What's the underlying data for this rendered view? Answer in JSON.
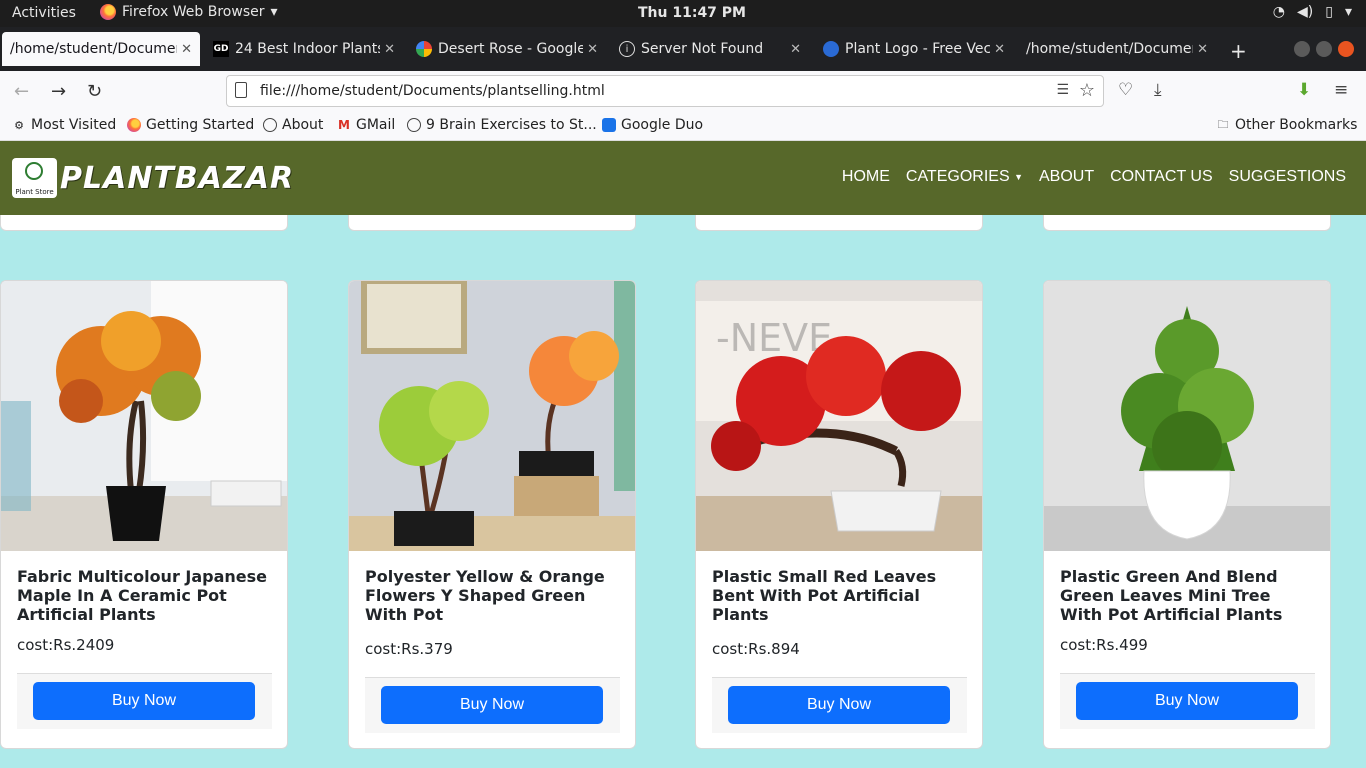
{
  "system_bar": {
    "activities": "Activities",
    "app_menu": "Firefox Web Browser",
    "clock": "Thu 11:47 PM"
  },
  "tabs": [
    {
      "label": "/home/student/Documen",
      "favicon": "none",
      "active": true
    },
    {
      "label": "24 Best Indoor Plants",
      "favicon": "gd-icon",
      "active": false
    },
    {
      "label": "Desert Rose - Google",
      "favicon": "google-icon",
      "active": false
    },
    {
      "label": "Server Not Found",
      "favicon": "info-icon",
      "active": false
    },
    {
      "label": "Plant Logo - Free Vect",
      "favicon": "logo-icon",
      "active": false
    },
    {
      "label": "/home/student/Documen",
      "favicon": "none",
      "active": false
    }
  ],
  "address_bar": {
    "url": "file:///home/student/Documents/plantselling.html"
  },
  "bookmarks": {
    "items": [
      "Most Visited",
      "Getting Started",
      "About",
      "GMail",
      "9 Brain Exercises to St...",
      "Google Duo"
    ],
    "other": "Other Bookmarks"
  },
  "site": {
    "logo_caption": "Plant Store",
    "brand": "PLANTBAZAR",
    "nav": {
      "home": "HOME",
      "categories": "CATEGORIES",
      "about": "ABOUT",
      "contact": "CONTACT US",
      "suggestions": "SUGGESTIONS"
    }
  },
  "products": [
    {
      "title": "Fabric Multicolour Japanese Maple In A Ceramic Pot Artificial Plants",
      "cost": "cost:Rs.2409",
      "button": "Buy Now",
      "foliage": "#e07a1f",
      "pot": "#111111"
    },
    {
      "title": "Polyester Yellow & Orange Flowers Y Shaped Green With Pot",
      "cost": "cost:Rs.379",
      "button": "Buy Now",
      "foliage": "#9ccc3a",
      "pot": "#1b1b1b"
    },
    {
      "title": "Plastic Small Red Leaves Bent With Pot Artificial Plants",
      "cost": "cost:Rs.894",
      "button": "Buy Now",
      "foliage": "#d41c1c",
      "pot": "#f2f2f2"
    },
    {
      "title": "Plastic Green And Blend Green Leaves Mini Tree With Pot Artificial Plants",
      "cost": "cost:Rs.499",
      "button": "Buy Now",
      "foliage": "#4a8a22",
      "pot": "#ffffff"
    }
  ],
  "colors": {
    "header": "#57682a",
    "page_bg": "#aeeaea",
    "button": "#0d6efd"
  }
}
